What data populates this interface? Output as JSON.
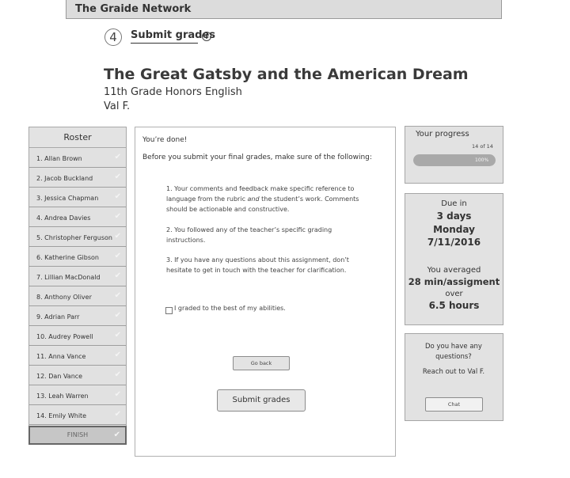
{
  "app": {
    "title": "The Graide Network"
  },
  "step": {
    "number": "4",
    "label": "Submit grades",
    "info_icon": "info-icon"
  },
  "assignment": {
    "title": "The Great Gatsby and the American Dream",
    "course": "11th Grade Honors English",
    "student": "Val F."
  },
  "roster": {
    "title": "Roster",
    "items": [
      {
        "label": "1.  Allan Brown"
      },
      {
        "label": "2.  Jacob Buckland"
      },
      {
        "label": "3.  Jessica Chapman"
      },
      {
        "label": "4.  Andrea Davies"
      },
      {
        "label": "5.  Christopher Ferguson"
      },
      {
        "label": "6.  Katherine  Gibson"
      },
      {
        "label": "7.  Lillian MacDonald"
      },
      {
        "label": "8.  Anthony Oliver"
      },
      {
        "label": "9.  Adrian Parr"
      },
      {
        "label": "10. Audrey Powell"
      },
      {
        "label": "11. Anna Vance"
      },
      {
        "label": "12. Dan Vance"
      },
      {
        "label": "13. Leah Warren"
      },
      {
        "label": "14. Emily White"
      }
    ],
    "finish_label": "FINISH",
    "check_icon": "checkmark-icon"
  },
  "main": {
    "done": "You’re done!",
    "before": "Before you submit your final grades, make sure of the following:",
    "items": [
      "1. Your comments and feedback make specific reference to language from the rubric and the student’s work. Comments should be actionable and constructive.",
      "2. You followed any of the teacher’s specific grading instructions.",
      "3. If you have any questions about this assignment, don’t hesitate to get in touch with the teacher for clarification."
    ],
    "checkbox_label": "I graded to the best of my abilities.",
    "checkbox_checked": false,
    "go_back": "Go back",
    "submit": "Submit grades"
  },
  "progress": {
    "title": "Your progress",
    "count": "14 of 14",
    "percent_label": "100%",
    "fraction": 1.0
  },
  "due": {
    "due_in_label": "Due in",
    "days": "3 days",
    "weekday": "Monday",
    "date": "7/11/2016",
    "averaged_label": "You averaged",
    "average": "28 min/assigment",
    "over_label": "over",
    "hours": "6.5 hours"
  },
  "help": {
    "question": "Do you have any questions?",
    "reach": "Reach out to Val F.",
    "chat": "Chat"
  }
}
